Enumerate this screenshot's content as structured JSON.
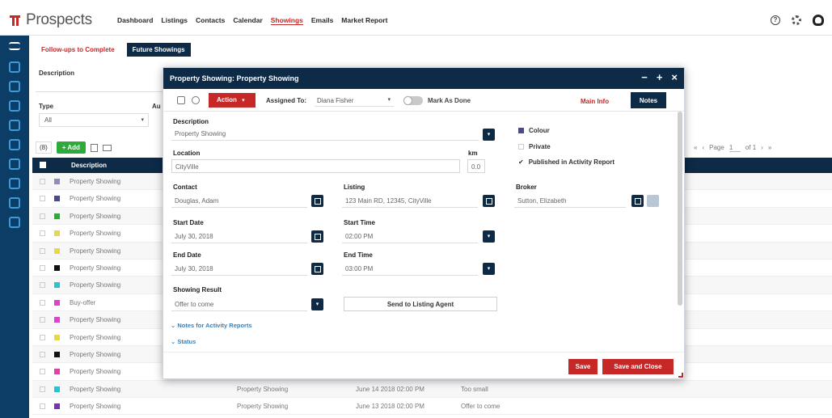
{
  "app": {
    "title": "Prospects"
  },
  "nav": [
    "Dashboard",
    "Listings",
    "Contacts",
    "Calendar",
    "Showings",
    "Emails",
    "Market Report"
  ],
  "nav_active": 4,
  "top_icons": [
    "help-icon",
    "gear-icon",
    "user-icon"
  ],
  "sidebar_icons": [
    "menu-icon",
    "alert-icon",
    "money-icon",
    "cloud-icon",
    "chart-icon",
    "compass-icon",
    "calendar-icon",
    "document-icon",
    "tag-icon",
    "book-icon"
  ],
  "bg": {
    "tabs": [
      "Follow-ups to Complete",
      "Future Showings"
    ],
    "description_label": "Description",
    "type_label": "Type",
    "type_value": "All",
    "au_label": "Au",
    "count": "(8)",
    "add_label": "+ Add",
    "pager": [
      "Page",
      "of 1"
    ],
    "column_description": "Description",
    "rows": [
      {
        "color": "#8d8dbf",
        "desc": "Property Showing",
        "c3": "",
        "c4": "",
        "c5": ""
      },
      {
        "color": "#4a4a8a",
        "desc": "Property Showing",
        "c3": "",
        "c4": "",
        "c5": ""
      },
      {
        "color": "#2eaa3d",
        "desc": "Property Showing",
        "c3": "",
        "c4": "",
        "c5": ""
      },
      {
        "color": "#e6d84a",
        "desc": "Property Showing",
        "c3": "",
        "c4": "",
        "c5": ""
      },
      {
        "color": "#e6d84a",
        "desc": "Property Showing",
        "c3": "",
        "c4": "",
        "c5": ""
      },
      {
        "color": "#111111",
        "desc": "Property Showing",
        "c3": "",
        "c4": "",
        "c5": ""
      },
      {
        "color": "#27c4d4",
        "desc": "Property Showing",
        "c3": "",
        "c4": "",
        "c5": ""
      },
      {
        "color": "#e040d0",
        "desc": "Buy-offer",
        "c3": "",
        "c4": "",
        "c5": ""
      },
      {
        "color": "#e040d0",
        "desc": "Property Showing",
        "c3": "",
        "c4": "",
        "c5": ""
      },
      {
        "color": "#e6d84a",
        "desc": "Property Showing",
        "c3": "",
        "c4": "",
        "c5": ""
      },
      {
        "color": "#111111",
        "desc": "Property Showing",
        "c3": "",
        "c4": "",
        "c5": ""
      },
      {
        "color": "#e040a0",
        "desc": "Property Showing",
        "c3": "",
        "c4": "",
        "c5": ""
      },
      {
        "color": "#27c4d4",
        "desc": "Property Showing",
        "c3": "Property Showing",
        "c4": "June 14 2018 02:00 PM",
        "c5": "Too small"
      },
      {
        "color": "#7b2fbf",
        "desc": "Property Showing",
        "c3": "Property Showing",
        "c4": "June 13 2018 02:00 PM",
        "c5": "Offer to come"
      }
    ]
  },
  "modal": {
    "title": "Property Showing: Property Showing",
    "controls": [
      "−",
      "+",
      "×"
    ],
    "action_label": "Action",
    "assigned_label": "Assigned To:",
    "assigned_value": "Diana Fisher",
    "mark_done_label": "Mark As Done",
    "tab_main": "Main Info",
    "tab_notes": "Notes",
    "description_label": "Description",
    "description_value": "Property Showing",
    "location_label": "Location",
    "location_value": "CityVille",
    "km_label": "km",
    "km_value": "0.0",
    "colour_label": "Colour",
    "private_label": "Private",
    "published_label": "Published in Activity Report",
    "contact_label": "Contact",
    "contact_value": "Douglas, Adam",
    "listing_label": "Listing",
    "listing_value": "123 Main RD, 12345, CityVille",
    "broker_label": "Broker",
    "broker_value": "Sutton, Elizabeth",
    "start_date_label": "Start Date",
    "start_date_value": "July 30, 2018",
    "start_time_label": "Start Time",
    "start_time_value": "02:00 PM",
    "end_date_label": "End Date",
    "end_date_value": "July 30, 2018",
    "end_time_label": "End Time",
    "end_time_value": "03:00 PM",
    "result_label": "Showing Result",
    "result_value": "Offer to come",
    "send_label": "Send to Listing Agent",
    "notes_section": "Notes for Activity Reports",
    "status_section": "Status",
    "save_label": "Save",
    "save_close_label": "Save and Close"
  }
}
